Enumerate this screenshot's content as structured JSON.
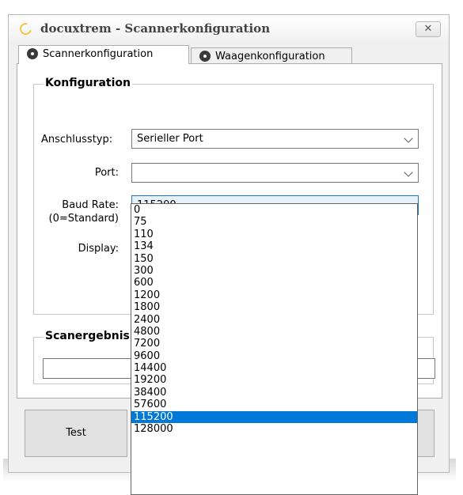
{
  "window": {
    "title": "docuxtrem - Scannerkonfiguration",
    "close_label": "✕"
  },
  "tabs": [
    {
      "label": "Scannerkonfiguration",
      "icon": "gear-icon",
      "active": true
    },
    {
      "label": "Waagenkonfiguration",
      "icon": "gear-icon",
      "active": false
    }
  ],
  "config_group": {
    "title": "Konfiguration",
    "anschlusstyp_label": "Anschlusstyp:",
    "anschlusstyp_value": "Serieller Port",
    "port_label": "Port:",
    "port_value": "",
    "baud_label_line1": "Baud Rate:",
    "baud_label_line2": "(0=Standard)",
    "baud_value": "115200",
    "display_label": "Display:"
  },
  "scan_group": {
    "title": "Scanergebnis",
    "result_value": ""
  },
  "buttons": {
    "test_label": "Test"
  },
  "baud_options": [
    "0",
    "75",
    "110",
    "134",
    "150",
    "300",
    "600",
    "1200",
    "1800",
    "2400",
    "4800",
    "7200",
    "9600",
    "14400",
    "19200",
    "38400",
    "57600",
    "115200",
    "128000"
  ],
  "baud_selected": "115200",
  "colors": {
    "selection": "#0078d7",
    "focus_border": "#1f75cc",
    "window_bg": "#f0f0f0"
  }
}
